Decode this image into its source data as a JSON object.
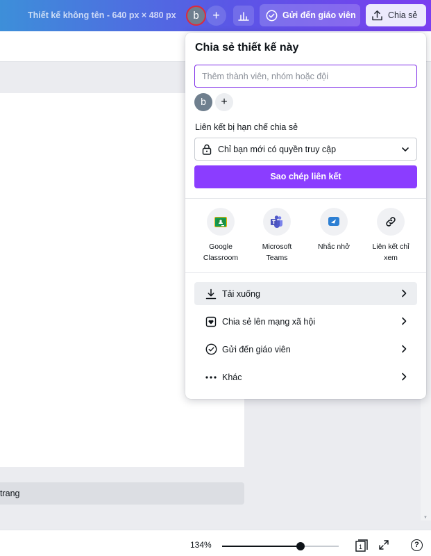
{
  "topbar": {
    "doc_title": "Thiết kế không tên - 640 px × 480 px",
    "avatar_letter": "b",
    "add_symbol": "+",
    "send_teacher_label": "Gửi đến giáo viên",
    "share_label": "Chia sẻ"
  },
  "share_panel": {
    "title": "Chia sẻ thiết kế này",
    "member_input_placeholder": "Thêm thành viên, nhóm hoặc đội",
    "member_avatar_letter": "b",
    "add_member_symbol": "+",
    "link_section_label": "Liên kết bị hạn chế chia sẻ",
    "access_option": "Chỉ bạn mới có quyền truy cập",
    "copy_link_label": "Sao chép liên kết",
    "apps": [
      {
        "label_line1": "Google",
        "label_line2": "Classroom",
        "icon": "google-classroom-icon"
      },
      {
        "label_line1": "Microsoft",
        "label_line2": "Teams",
        "icon": "microsoft-teams-icon"
      },
      {
        "label_line1": "Nhắc nhở",
        "label_line2": "",
        "icon": "reminder-icon"
      },
      {
        "label_line1": "Liên kết chỉ",
        "label_line2": "xem",
        "icon": "view-only-link-icon"
      }
    ],
    "menu": [
      {
        "label": "Tải xuống",
        "icon": "download-icon"
      },
      {
        "label": "Chia sẻ lên mạng xã hội",
        "icon": "social-heart-icon"
      },
      {
        "label": "Gửi đến giáo viên",
        "icon": "check-circle-icon"
      },
      {
        "label": "Khác",
        "icon": "more-dots-icon"
      }
    ]
  },
  "canvas": {
    "add_page_label": "trang"
  },
  "bottom_bar": {
    "zoom_level": "134%",
    "zoom_fraction": 0.67,
    "page_number": "1",
    "help_symbol": "?"
  },
  "colors": {
    "accent": "#8b3dff",
    "input_focus": "#7d2ae8",
    "avatar_ring": "#e0293a"
  }
}
